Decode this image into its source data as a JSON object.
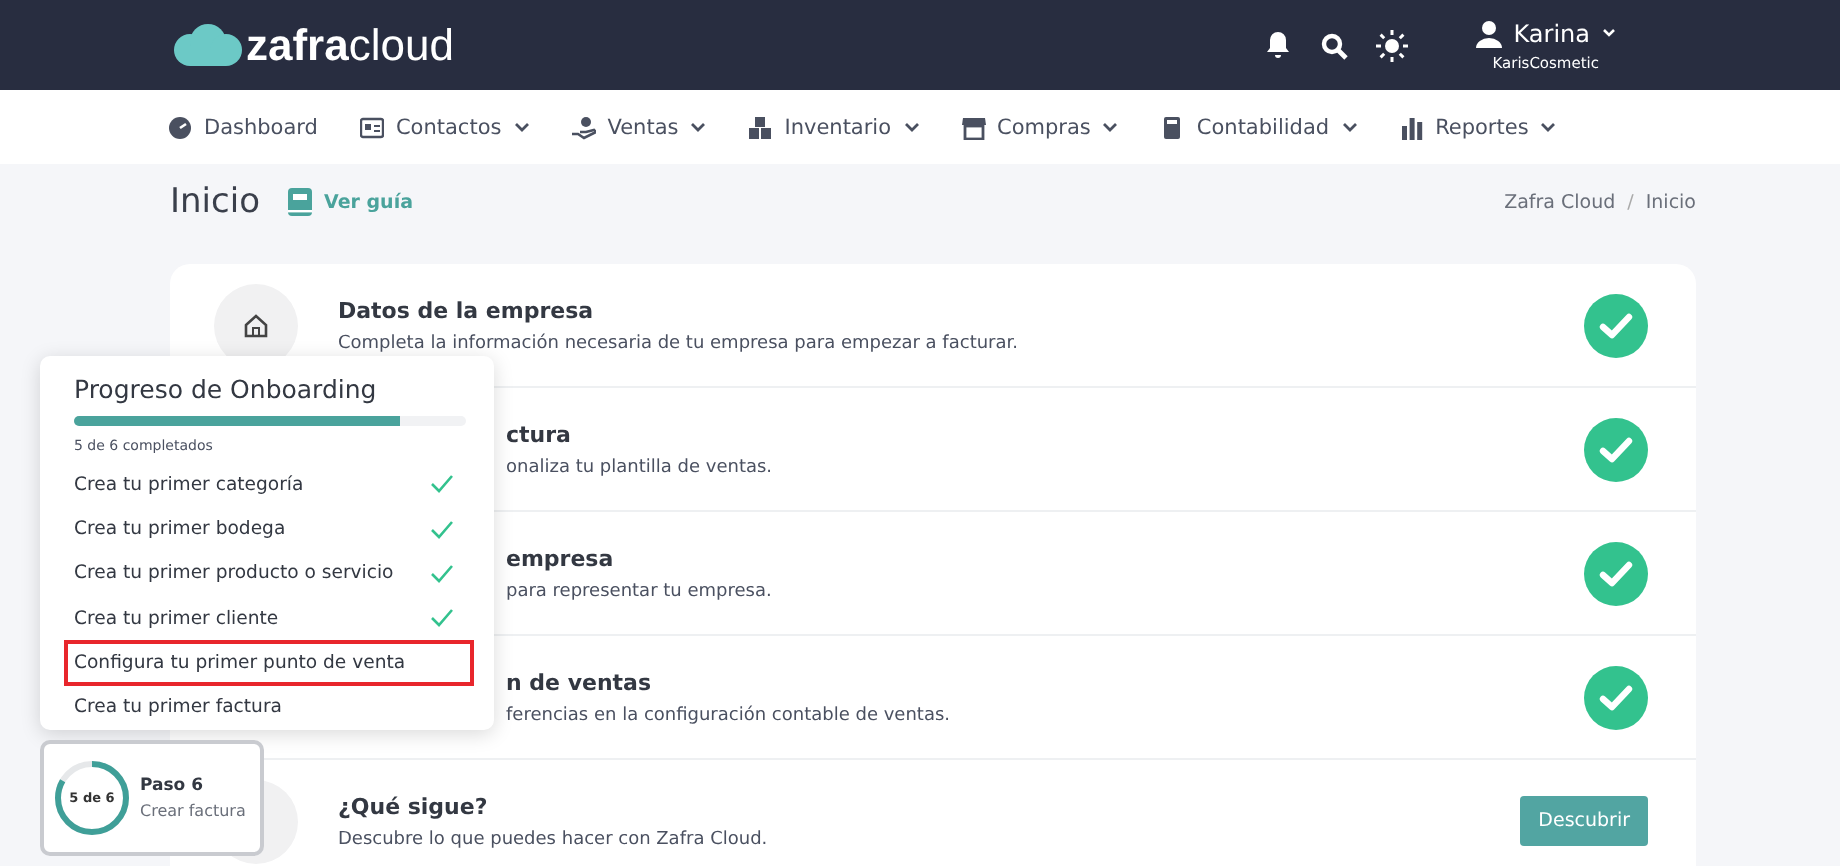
{
  "header": {
    "logo_bold": "zafra",
    "logo_light": "cloud",
    "user_name": "Karina",
    "company": "KarisCosmetic"
  },
  "nav": [
    {
      "label": "Dashboard",
      "dropdown": false
    },
    {
      "label": "Contactos",
      "dropdown": true
    },
    {
      "label": "Ventas",
      "dropdown": true
    },
    {
      "label": "Inventario",
      "dropdown": true
    },
    {
      "label": "Compras",
      "dropdown": true
    },
    {
      "label": "Contabilidad",
      "dropdown": true
    },
    {
      "label": "Reportes",
      "dropdown": true
    }
  ],
  "page": {
    "title": "Inicio",
    "guide_link": "Ver guía",
    "breadcrumb": [
      "Zafra Cloud",
      "Inicio"
    ],
    "breadcrumb_separator": "/"
  },
  "steps": [
    {
      "title": "Datos de la empresa",
      "description": "Completa la información necesaria de tu empresa para empezar a facturar.",
      "kind": "done",
      "partially_hidden": false
    },
    {
      "title": "ctura",
      "description": "onaliza tu plantilla de ventas.",
      "kind": "done",
      "partially_hidden": true
    },
    {
      "title": "empresa",
      "description": "para representar tu empresa.",
      "kind": "done",
      "partially_hidden": true
    },
    {
      "title": "n de ventas",
      "description": "ferencias en la configuración contable de ventas.",
      "kind": "done",
      "partially_hidden": true
    },
    {
      "title": "¿Qué sigue?",
      "description": "Descubre lo que puedes hacer con Zafra Cloud.",
      "kind": "button",
      "button_label": "Descubrir",
      "partially_hidden": false
    }
  ],
  "onboarding": {
    "title": "Progreso de Onboarding",
    "level": 0.833,
    "count_text": "5 de 6 completados",
    "items": [
      {
        "label": "Crea tu primer categoría",
        "done": true,
        "highlighted": false
      },
      {
        "label": "Crea tu primer bodega",
        "done": true,
        "highlighted": false
      },
      {
        "label": "Crea tu primer producto o servicio",
        "done": true,
        "highlighted": false
      },
      {
        "label": "Crea tu primer cliente",
        "done": true,
        "highlighted": false
      },
      {
        "label": "Configura tu primer punto de venta",
        "done": false,
        "highlighted": true
      },
      {
        "label": "Crea tu primer factura",
        "done": false,
        "highlighted": false
      }
    ]
  },
  "step_badge": {
    "ring_text": "5 de 6",
    "level": 0.833,
    "title": "Paso 6",
    "subtitle": "Crear factura"
  }
}
